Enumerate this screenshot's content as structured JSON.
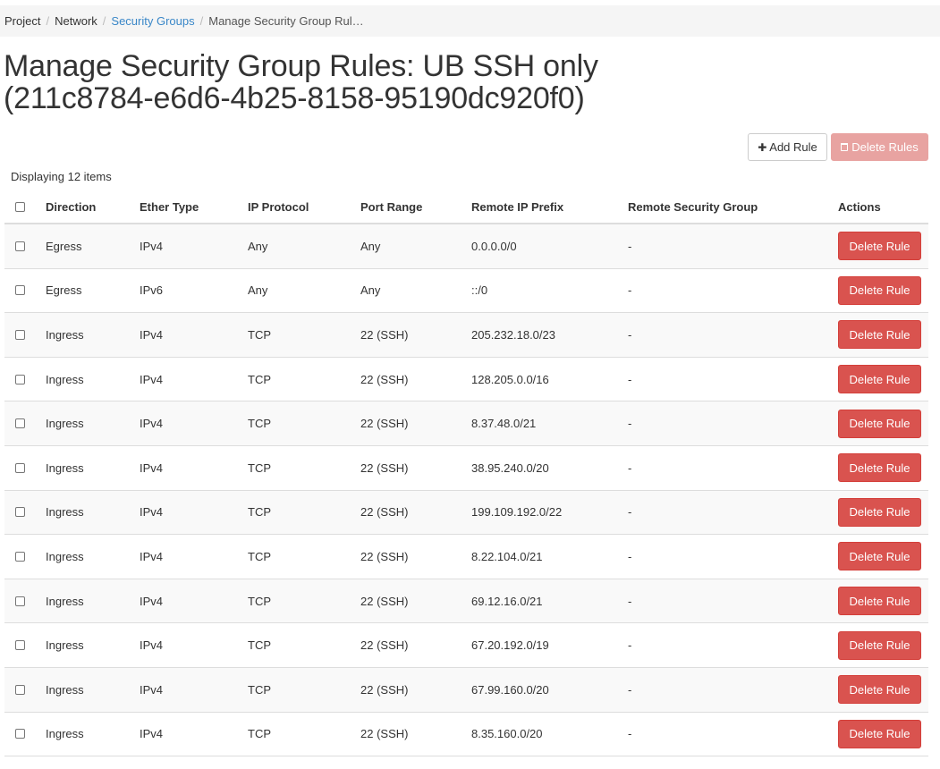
{
  "breadcrumb": {
    "items": [
      "Project",
      "Network",
      "Security Groups",
      "Manage Security Group Rul…"
    ]
  },
  "title_line1": "Manage Security Group Rules: UB SSH only",
  "title_line2": "(211c8784-e6d6-4b25-8158-95190dc920f0)",
  "toolbar": {
    "add_label": "Add Rule",
    "delete_label": "Delete Rules",
    "add_icon": "plus-icon",
    "delete_icon": "trash-icon"
  },
  "count_text": "Displaying 12 items",
  "columns": [
    "Direction",
    "Ether Type",
    "IP Protocol",
    "Port Range",
    "Remote IP Prefix",
    "Remote Security Group",
    "Actions"
  ],
  "row_action_label": "Delete Rule",
  "rows": [
    {
      "direction": "Egress",
      "ether": "IPv4",
      "protocol": "Any",
      "port": "Any",
      "prefix": "0.0.0.0/0",
      "group": "-"
    },
    {
      "direction": "Egress",
      "ether": "IPv6",
      "protocol": "Any",
      "port": "Any",
      "prefix": "::/0",
      "group": "-"
    },
    {
      "direction": "Ingress",
      "ether": "IPv4",
      "protocol": "TCP",
      "port": "22 (SSH)",
      "prefix": "205.232.18.0/23",
      "group": "-"
    },
    {
      "direction": "Ingress",
      "ether": "IPv4",
      "protocol": "TCP",
      "port": "22 (SSH)",
      "prefix": "128.205.0.0/16",
      "group": "-"
    },
    {
      "direction": "Ingress",
      "ether": "IPv4",
      "protocol": "TCP",
      "port": "22 (SSH)",
      "prefix": "8.37.48.0/21",
      "group": "-"
    },
    {
      "direction": "Ingress",
      "ether": "IPv4",
      "protocol": "TCP",
      "port": "22 (SSH)",
      "prefix": "38.95.240.0/20",
      "group": "-"
    },
    {
      "direction": "Ingress",
      "ether": "IPv4",
      "protocol": "TCP",
      "port": "22 (SSH)",
      "prefix": "199.109.192.0/22",
      "group": "-"
    },
    {
      "direction": "Ingress",
      "ether": "IPv4",
      "protocol": "TCP",
      "port": "22 (SSH)",
      "prefix": "8.22.104.0/21",
      "group": "-"
    },
    {
      "direction": "Ingress",
      "ether": "IPv4",
      "protocol": "TCP",
      "port": "22 (SSH)",
      "prefix": "69.12.16.0/21",
      "group": "-"
    },
    {
      "direction": "Ingress",
      "ether": "IPv4",
      "protocol": "TCP",
      "port": "22 (SSH)",
      "prefix": "67.20.192.0/19",
      "group": "-"
    },
    {
      "direction": "Ingress",
      "ether": "IPv4",
      "protocol": "TCP",
      "port": "22 (SSH)",
      "prefix": "67.99.160.0/20",
      "group": "-"
    },
    {
      "direction": "Ingress",
      "ether": "IPv4",
      "protocol": "TCP",
      "port": "22 (SSH)",
      "prefix": "8.35.160.0/20",
      "group": "-"
    }
  ],
  "colors": {
    "link": "#3a87c8",
    "danger": "#d9534f",
    "danger_disabled": "#e8a3a1",
    "row_stripe": "#f9f9f9"
  }
}
